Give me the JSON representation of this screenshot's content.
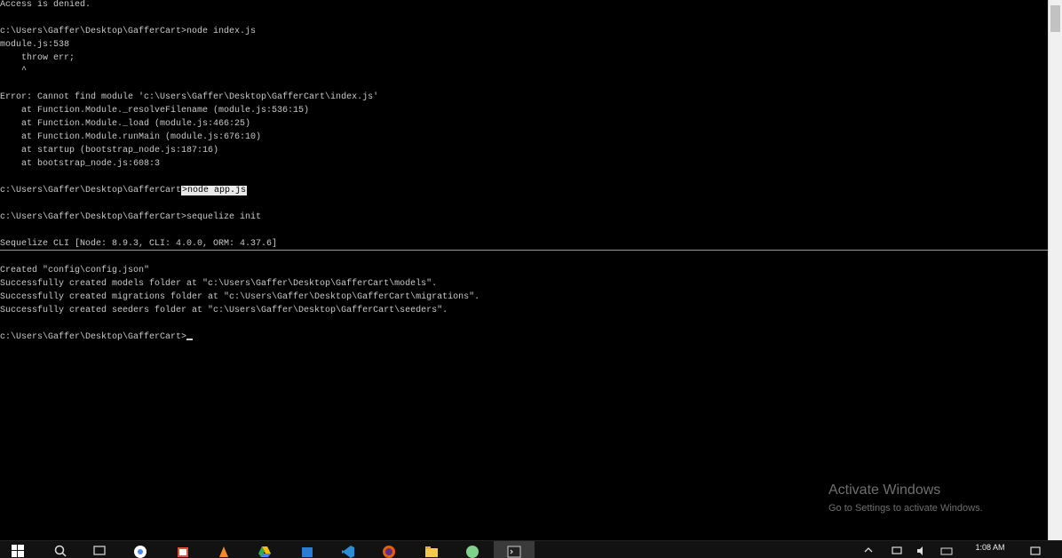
{
  "console": {
    "lines": [
      "Access is denied.",
      "",
      "c:\\Users\\Gaffer\\Desktop\\GafferCart>node index.js",
      "module.js:538",
      "    throw err;",
      "    ^",
      "",
      "Error: Cannot find module 'c:\\Users\\Gaffer\\Desktop\\GafferCart\\index.js'",
      "    at Function.Module._resolveFilename (module.js:536:15)",
      "    at Function.Module._load (module.js:466:25)",
      "    at Function.Module.runMain (module.js:676:10)",
      "    at startup (bootstrap_node.js:187:16)",
      "    at bootstrap_node.js:608:3",
      "",
      "c:\\Users\\Gaffer\\Desktop\\GafferCart",
      "",
      "c:\\Users\\Gaffer\\Desktop\\GafferCart>sequelize init",
      "",
      "Sequelize CLI [Node: 8.9.3, CLI: 4.0.0, ORM: 4.37.6]",
      "",
      "Created \"config\\config.json\"",
      "Successfully created models folder at \"c:\\Users\\Gaffer\\Desktop\\GafferCart\\models\".",
      "Successfully created migrations folder at \"c:\\Users\\Gaffer\\Desktop\\GafferCart\\migrations\".",
      "Successfully created seeders folder at \"c:\\Users\\Gaffer\\Desktop\\GafferCart\\seeders\".",
      "",
      "c:\\Users\\Gaffer\\Desktop\\GafferCart>"
    ],
    "selected_text": ">node app.js"
  },
  "watermark": {
    "title": "Activate Windows",
    "subtitle": "Go to Settings to activate Windows."
  },
  "taskbar": {
    "time": "1:08 AM",
    "icons": [
      "start-icon",
      "search-icon",
      "task-view-icon",
      "chrome-icon",
      "paint-icon",
      "vlc-icon",
      "google-drive-icon",
      "photos-icon",
      "visual-studio-code-icon",
      "firefox-icon",
      "file-explorer-icon",
      "app-icon",
      "command-prompt-icon"
    ]
  },
  "colors": {
    "console_background": "#000000",
    "console_text": "#c9c9c9",
    "selection_background": "#eaeaea"
  }
}
